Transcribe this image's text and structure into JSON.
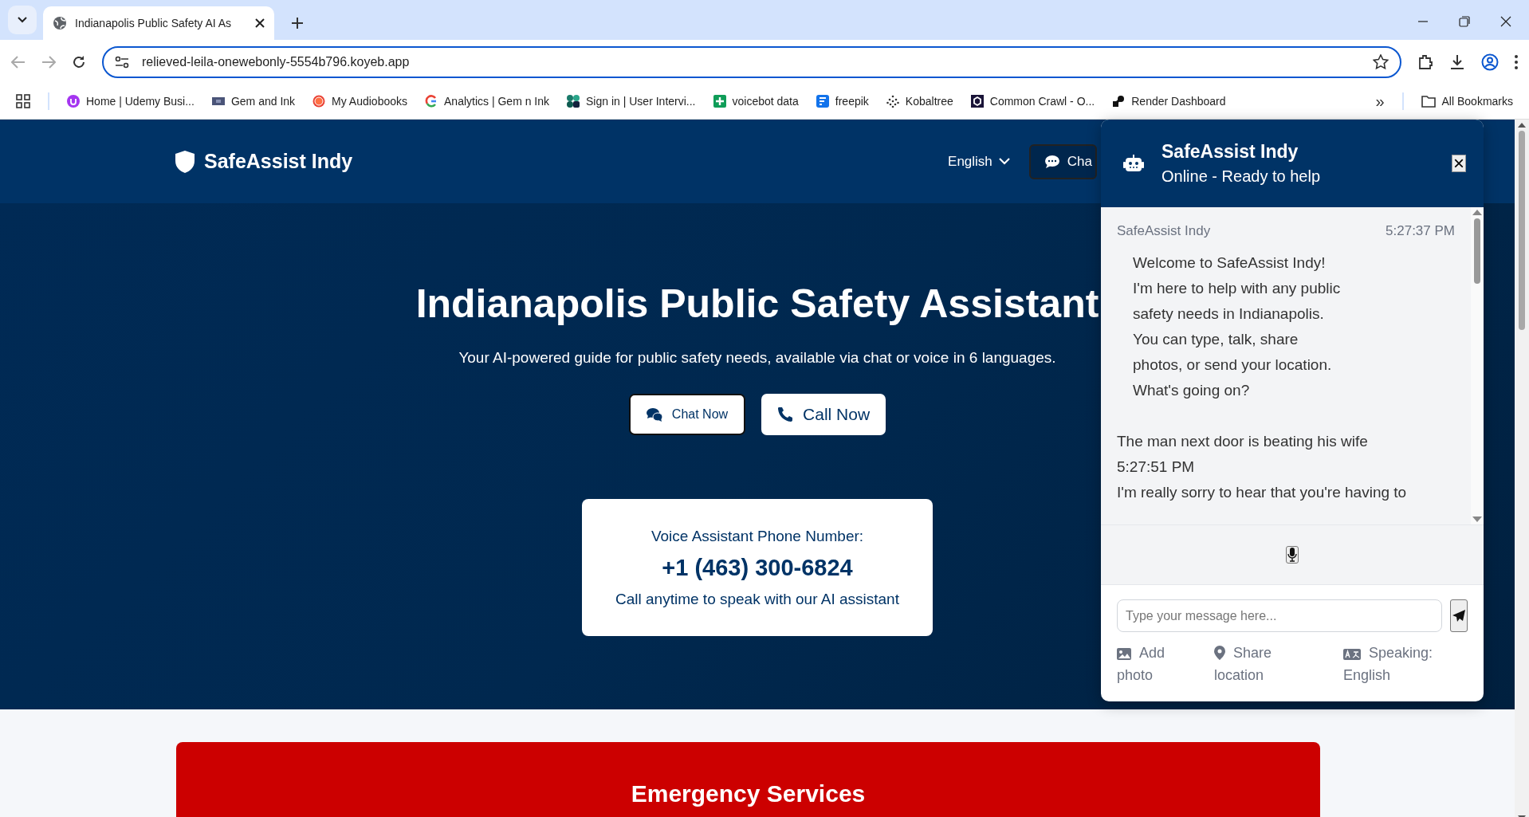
{
  "browser": {
    "tab_title": "Indianapolis Public Safety AI As",
    "url": "relieved-leila-onewebonly-5554b796.koyeb.app",
    "bookmarks": [
      {
        "label": "Home | Udemy Busi..."
      },
      {
        "label": "Gem and Ink"
      },
      {
        "label": "My Audiobooks"
      },
      {
        "label": "Analytics | Gem n Ink"
      },
      {
        "label": "Sign in | User Intervi..."
      },
      {
        "label": "voicebot data"
      },
      {
        "label": "freepik"
      },
      {
        "label": "Kobaltree"
      },
      {
        "label": "Common Crawl - O..."
      },
      {
        "label": "Render Dashboard"
      }
    ],
    "all_bookmarks": "All Bookmarks",
    "more": "»"
  },
  "header": {
    "brand": "SafeAssist Indy",
    "language": "English",
    "chat_button": "Cha"
  },
  "hero": {
    "title": "Indianapolis Public Safety Assistant",
    "subtitle": "Your AI-powered guide for public safety needs, available via chat or voice in 6 languages.",
    "buttons": [
      {
        "kind": "chat",
        "label": "Chat Now"
      },
      {
        "kind": "call",
        "label": "Call Now"
      }
    ]
  },
  "phone_card": {
    "label": "Voice Assistant Phone Number:",
    "number": "+1 (463) 300-6824",
    "note": "Call anytime to speak with our AI assistant"
  },
  "emergency": {
    "title": "Emergency Services"
  },
  "chat": {
    "title": "SafeAssist Indy",
    "status": "Online - Ready to help",
    "close": "×",
    "messages": [
      {
        "kind": "bot_header",
        "sender": "SafeAssist Indy",
        "time": "5:27:37 PM",
        "lines": [
          "Welcome to SafeAssist Indy!",
          "I'm here to help with any public",
          "safety needs in Indianapolis.",
          "You can type, talk, share",
          "photos, or send your location.",
          "What's going on?"
        ]
      },
      {
        "kind": "plain",
        "text": "The man next door is beating his wife"
      },
      {
        "kind": "plain",
        "text": "5:27:51 PM"
      },
      {
        "kind": "plain",
        "text": "I'm really sorry to hear that you're having to"
      }
    ],
    "placeholder": "Type your message here...",
    "actions": [
      {
        "kind": "photo",
        "label": "Add photo"
      },
      {
        "kind": "location",
        "label": "Share location"
      },
      {
        "kind": "language",
        "label": "Speaking: English"
      }
    ]
  }
}
